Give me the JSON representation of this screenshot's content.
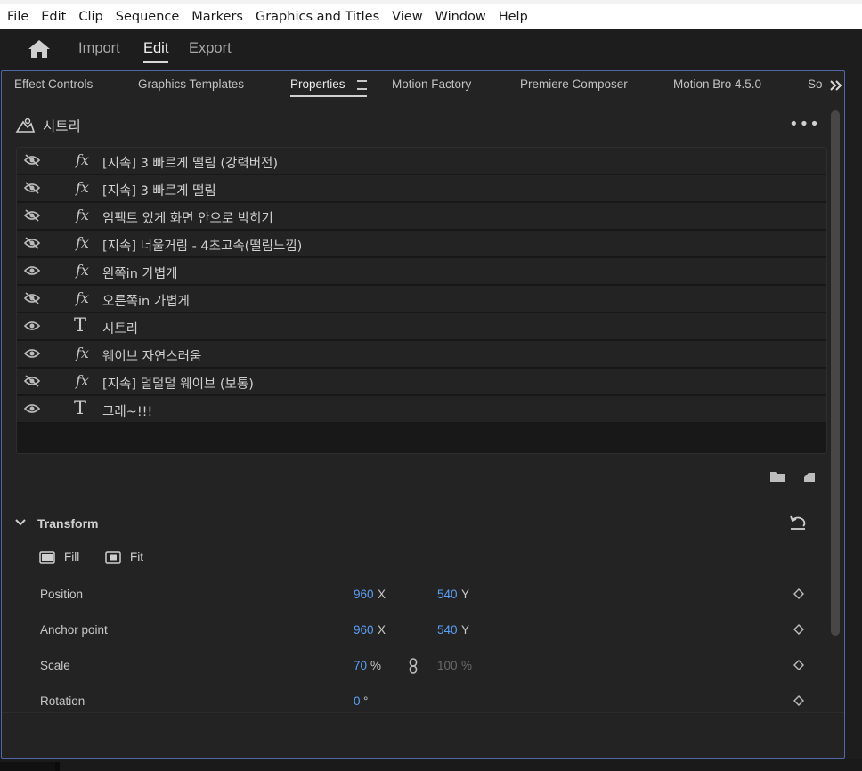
{
  "menubar": {
    "items": [
      "File",
      "Edit",
      "Clip",
      "Sequence",
      "Markers",
      "Graphics and Titles",
      "View",
      "Window",
      "Help"
    ]
  },
  "topnav": {
    "home_icon": "home-icon",
    "tabs": [
      "Import",
      "Edit",
      "Export"
    ],
    "active_tab": "Edit"
  },
  "panel_tabs": {
    "items": [
      "Effect Controls",
      "Graphics Templates",
      "Properties",
      "Motion Factory",
      "Premiere Composer",
      "Motion Bro 4.5.0",
      "So"
    ],
    "active": "Properties",
    "overflow_icon": "double-chevron-right-icon",
    "menu_icon": "hamburger-menu-icon"
  },
  "clip": {
    "name": "시트리",
    "more": "•••",
    "icon": "graphic-clip-icon"
  },
  "layers": [
    {
      "name": "[지속] 3 빠르게 떨림 (강력버전)",
      "type": "fx",
      "visible": false
    },
    {
      "name": "[지속] 3 빠르게 떨림",
      "type": "fx",
      "visible": false
    },
    {
      "name": "임팩트 있게 화면 안으로 박히기",
      "type": "fx",
      "visible": false
    },
    {
      "name": "[지속] 너울거림 - 4초고속(떨림느낌)",
      "type": "fx",
      "visible": false
    },
    {
      "name": "왼쪽in 가볍게",
      "type": "fx",
      "visible": true
    },
    {
      "name": "오른쪽in 가볍게",
      "type": "fx",
      "visible": false
    },
    {
      "name": "시트리",
      "type": "T",
      "visible": true
    },
    {
      "name": "웨이브 자연스러움",
      "type": "fx",
      "visible": true
    },
    {
      "name": "[지속] 덜덜덜 웨이브 (보통)",
      "type": "fx",
      "visible": false
    },
    {
      "name": "그래~!!!",
      "type": "T",
      "visible": true
    }
  ],
  "layer_type_labels": {
    "fx": "fx",
    "T": "T"
  },
  "layer_actions": {
    "folder_icon": "folder-icon",
    "new_layer_icon": "new-layer-icon"
  },
  "transform": {
    "title": "Transform",
    "reset_icon": "reset-icon",
    "fill_label": "Fill",
    "fit_label": "Fit",
    "position": {
      "label": "Position",
      "x": "960",
      "x_unit": "X",
      "y": "540",
      "y_unit": "Y"
    },
    "anchor": {
      "label": "Anchor point",
      "x": "960",
      "x_unit": "X",
      "y": "540",
      "y_unit": "Y"
    },
    "scale": {
      "label": "Scale",
      "value": "70",
      "unit": "%",
      "value2": "100",
      "unit2": "%"
    },
    "rotation": {
      "label": "Rotation",
      "value": "0",
      "unit": "°"
    }
  },
  "colors": {
    "accent_blue": "#5b9ff5",
    "panel_border": "#5266ab"
  }
}
